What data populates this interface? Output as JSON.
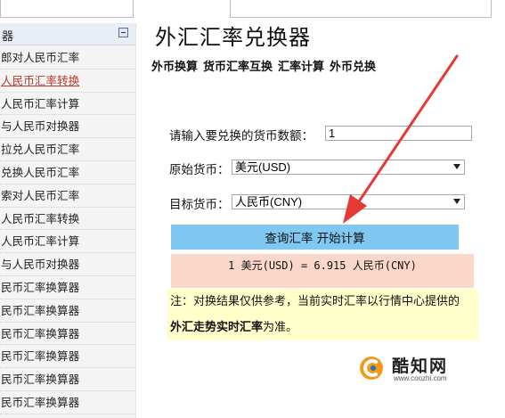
{
  "sidebar": {
    "header_label": "器",
    "items": [
      {
        "label": "郎对人民币汇率",
        "active": false
      },
      {
        "label": "人民币汇率转换",
        "active": true
      },
      {
        "label": "人民币汇率计算",
        "active": false
      },
      {
        "label": "与人民币对换器",
        "active": false
      },
      {
        "label": "拉兑人民币汇率",
        "active": false
      },
      {
        "label": "兑换人民币汇率",
        "active": false
      },
      {
        "label": "索对人民币汇率",
        "active": false
      },
      {
        "label": "人民币汇率转换",
        "active": false
      },
      {
        "label": "人民币汇率计算",
        "active": false
      },
      {
        "label": "与人民币对换器",
        "active": false
      },
      {
        "label": "民币汇率换算器",
        "active": false
      },
      {
        "label": "民币汇率换算器",
        "active": false
      },
      {
        "label": "民币汇率换算器",
        "active": false
      },
      {
        "label": "民币汇率换算器",
        "active": false
      },
      {
        "label": "民币汇率换算器",
        "active": false
      },
      {
        "label": "民币汇率换算器",
        "active": false
      },
      {
        "label": "民币汇率换算器",
        "active": false
      }
    ]
  },
  "main": {
    "title": "外汇汇率兑换器",
    "nav_links": [
      "外币换算",
      "货币汇率互换",
      "汇率计算",
      "外币兑换"
    ],
    "form": {
      "amount_label": "请输入要兑换的货币数额：",
      "amount_value": "1",
      "from_label": "原始货币：",
      "from_value": "美元(USD)",
      "to_label": "目标货币：",
      "to_value": "人民币(CNY)"
    },
    "query_button": "查询汇率 开始计算",
    "result": "1 美元(USD) = 6.915 人民币(CNY)",
    "note": {
      "line1": "注：对换结果仅供参考，当前实时汇率以行情中心提供的",
      "line2_bold": "外汇走势实时汇率",
      "line2_rest": "为准。"
    }
  },
  "watermark": {
    "name": "酷知网",
    "url": "www.coozhi.com"
  },
  "colors": {
    "button_bg": "#7ec8f1",
    "result_bg": "#fbd7c9",
    "note_bg": "#ffffcc",
    "arrow": "#e53935",
    "active_link": "#c0392b"
  }
}
